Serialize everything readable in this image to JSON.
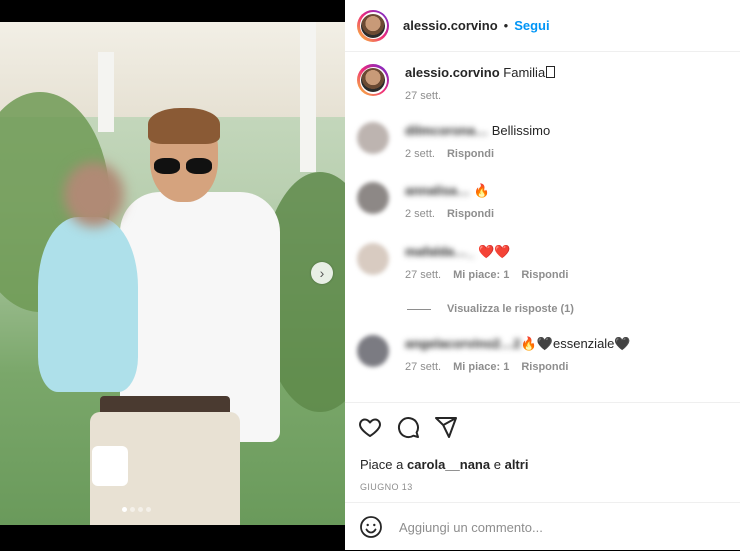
{
  "post": {
    "username": "alessio.corvino",
    "follow_label": "Segui",
    "bullet": "•",
    "caption": "Familia",
    "caption_time": "27 sett.",
    "carousel_total": 4,
    "carousel_active": 1,
    "next_glyph": "›"
  },
  "comments": [
    {
      "user": "dilmcorona…",
      "text": "Bellissimo",
      "emoji": "",
      "time": "2 sett.",
      "likes": "",
      "reply": "Rispondi"
    },
    {
      "user": "annalisa…",
      "text": "",
      "emoji": "🔥",
      "time": "2 sett.",
      "likes": "",
      "reply": "Rispondi"
    },
    {
      "user": "mafalda…_",
      "text": "",
      "emoji": "❤️❤️",
      "time": "27 sett.",
      "likes": "Mi piace: 1",
      "reply": "Rispondi"
    },
    {
      "user": "angelacorvino2…2",
      "text": "essenziale",
      "emoji": "🔥🖤",
      "emoji_after": "🖤",
      "time": "27 sett.",
      "likes": "Mi piace: 1",
      "reply": "Rispondi"
    }
  ],
  "view_replies": "Visualizza le risposte (1)",
  "likes": {
    "prefix": "Piace a",
    "user": "carola__nana",
    "joiner": "e",
    "others": "altri"
  },
  "post_date": "GIUGNO 13",
  "add_comment": {
    "placeholder": "Aggiungi un commento..."
  },
  "icons": [
    "heart-icon",
    "comment-icon",
    "share-icon",
    "emoji-icon",
    "chevron-right-icon"
  ]
}
